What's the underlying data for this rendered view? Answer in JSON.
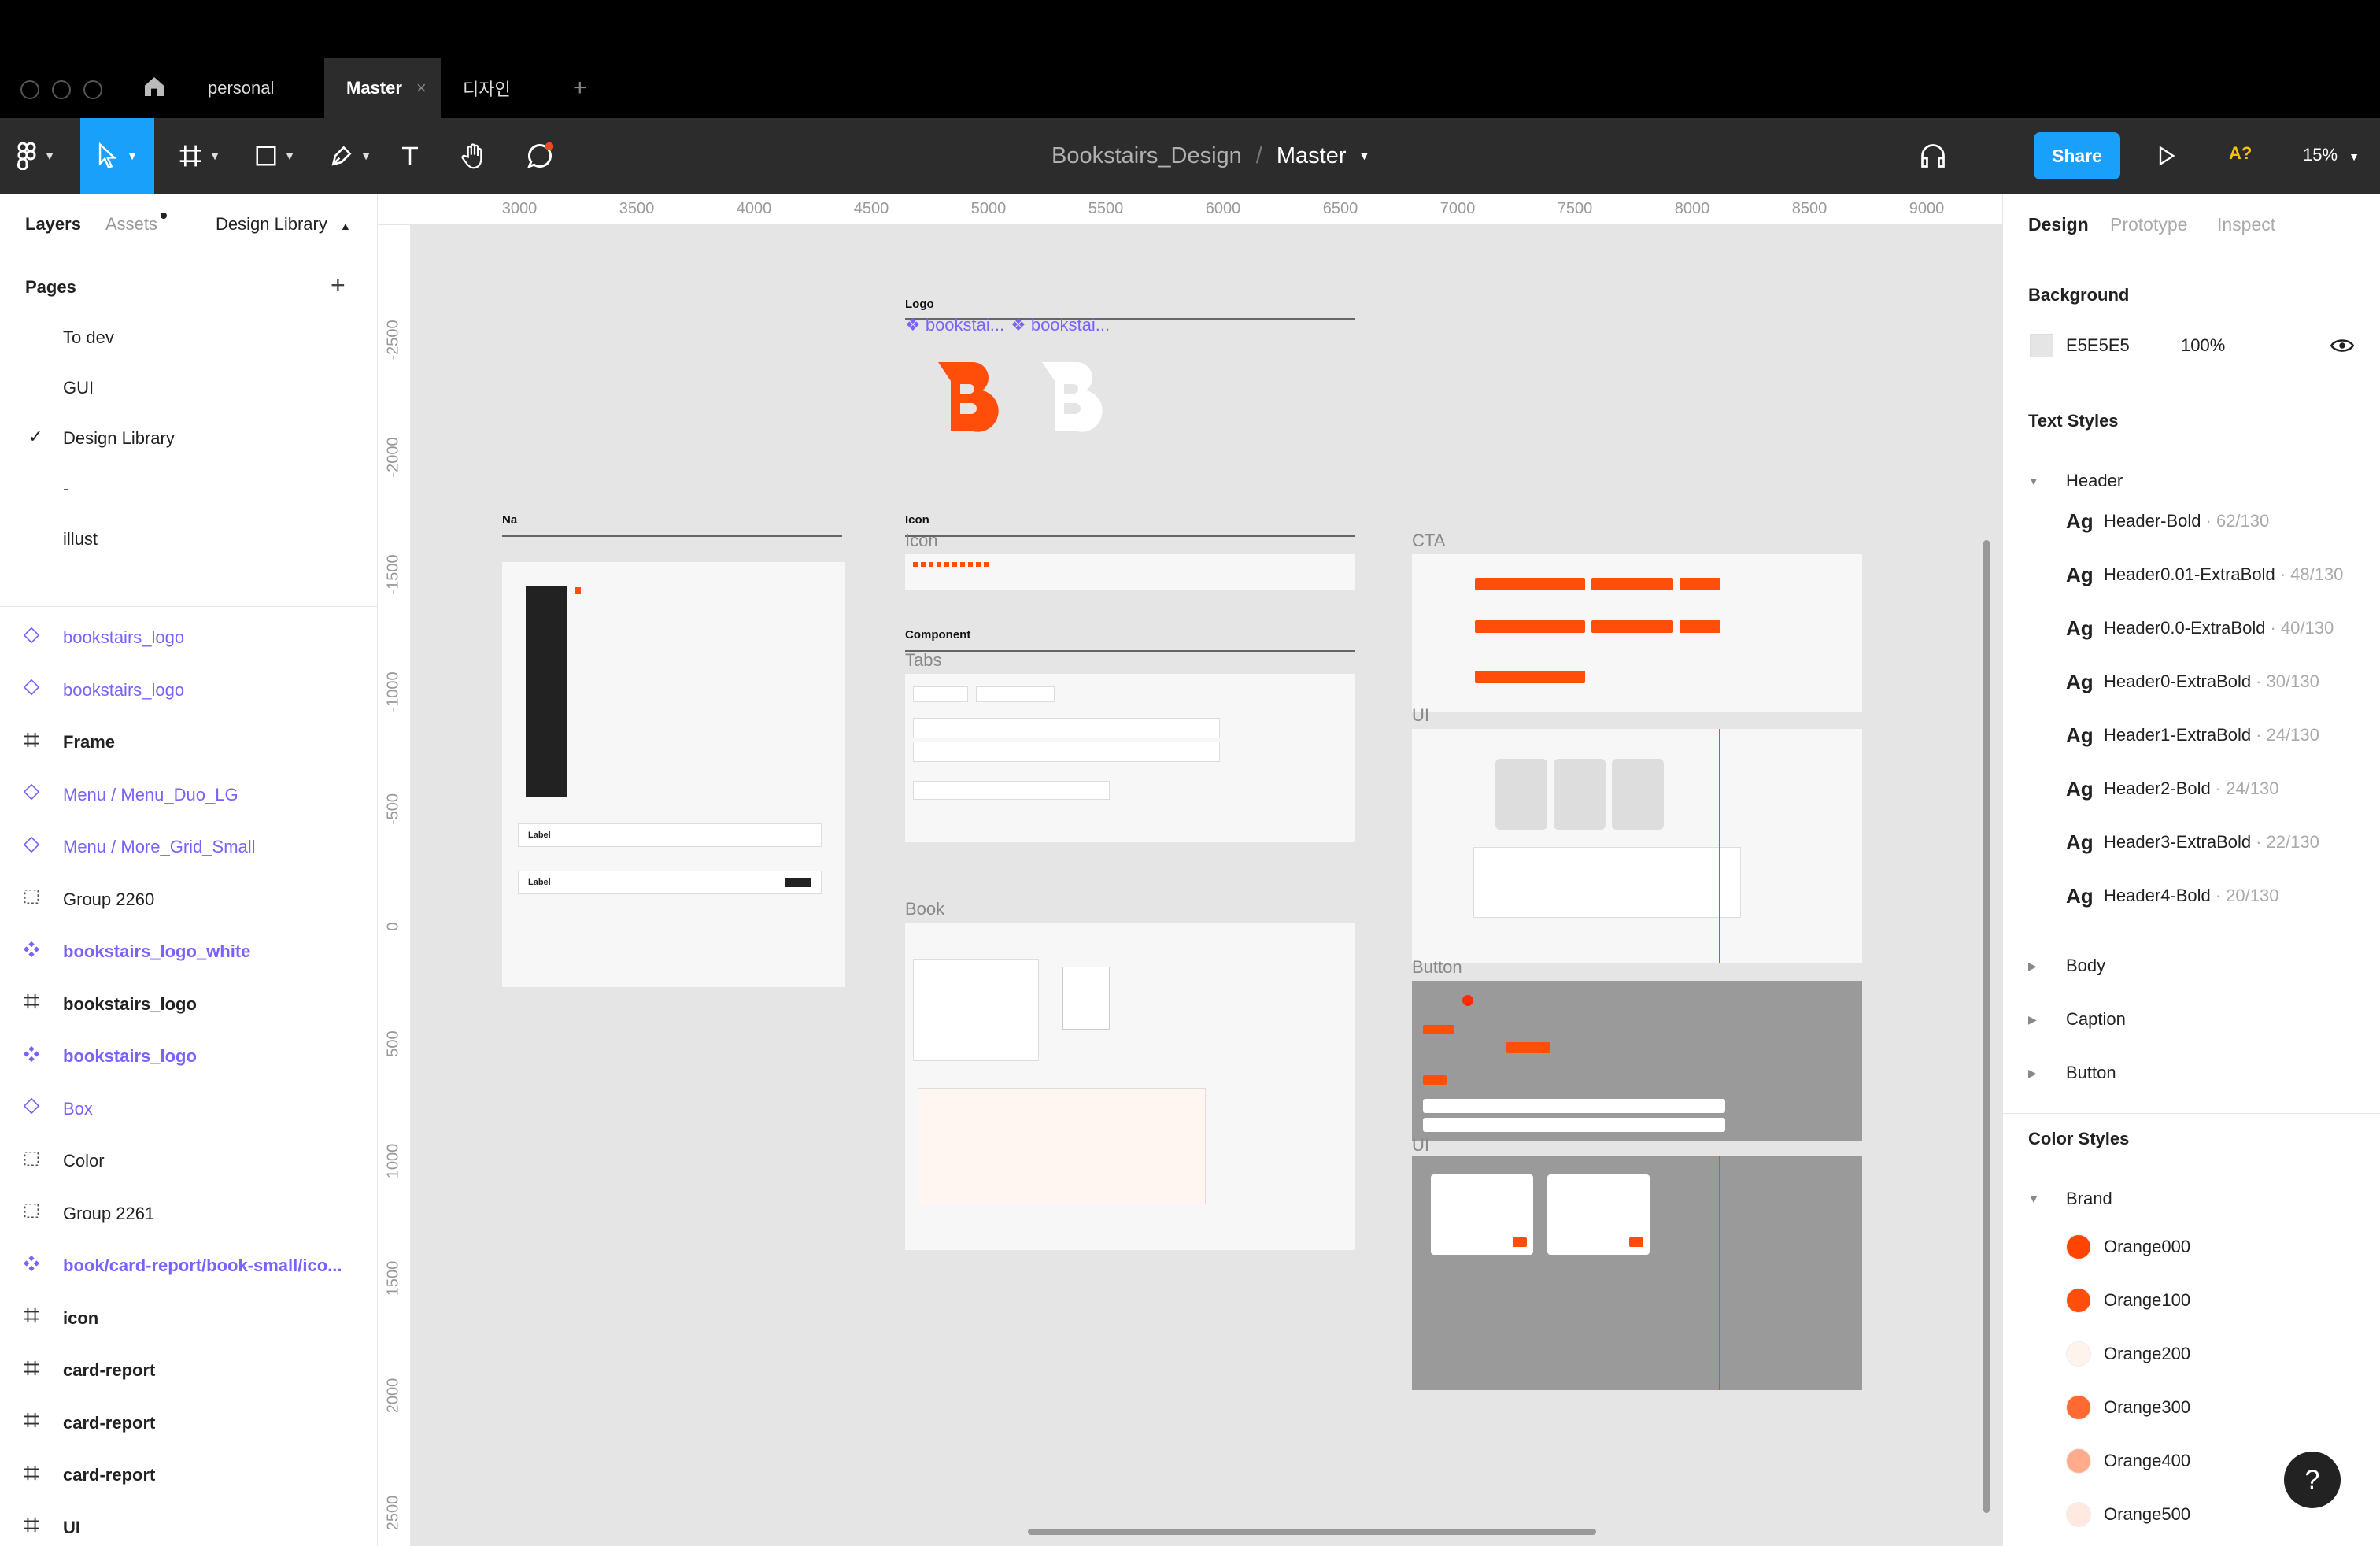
{
  "tabs": {
    "personal": "personal",
    "master": "Master",
    "master_close": "×",
    "design_kr": "디자인",
    "add": "+"
  },
  "toolbar": {
    "file_name": "Bookstairs_Design",
    "separator": "/",
    "page_name": "Master",
    "share": "Share",
    "a11y": "A?",
    "zoom": "15%"
  },
  "left_panel": {
    "tabs": {
      "layers": "Layers",
      "assets": "Assets",
      "library": "Design Library"
    },
    "pages_title": "Pages",
    "add_page": "+",
    "check": "✓",
    "pages": [
      "To dev",
      "GUI",
      "Design Library",
      "-",
      "illust"
    ],
    "layers": [
      {
        "name": "bookstairs_logo",
        "kind": "component-outline"
      },
      {
        "name": "bookstairs_logo",
        "kind": "component-outline"
      },
      {
        "name": "Frame",
        "kind": "frame"
      },
      {
        "name": "Menu / Menu_Duo_LG",
        "kind": "component-outline"
      },
      {
        "name": "Menu / More_Grid_Small",
        "kind": "component-outline"
      },
      {
        "name": "Group 2260",
        "kind": "group"
      },
      {
        "name": "bookstairs_logo_white",
        "kind": "component"
      },
      {
        "name": "bookstairs_logo",
        "kind": "frame"
      },
      {
        "name": "bookstairs_logo",
        "kind": "component"
      },
      {
        "name": "Box",
        "kind": "component-outline"
      },
      {
        "name": "Color",
        "kind": "group"
      },
      {
        "name": "Group 2261",
        "kind": "group"
      },
      {
        "name": "book/card-report/book-small/ico...",
        "kind": "component"
      },
      {
        "name": "icon",
        "kind": "frame"
      },
      {
        "name": "card-report",
        "kind": "frame"
      },
      {
        "name": "card-report",
        "kind": "frame"
      },
      {
        "name": "card-report",
        "kind": "frame"
      },
      {
        "name": "UI",
        "kind": "frame"
      },
      {
        "name": "UI",
        "kind": "frame"
      }
    ]
  },
  "rulers": {
    "h": [
      "3000",
      "3500",
      "4000",
      "4500",
      "5000",
      "5500",
      "6000",
      "6500",
      "7000",
      "7500",
      "8000",
      "8500",
      "9000"
    ],
    "v": [
      "-2500",
      "-2000",
      "-1500",
      "-1000",
      "-500",
      "0",
      "500",
      "1000",
      "1500",
      "2000",
      "2500"
    ]
  },
  "canvas": {
    "logo_label": "Logo",
    "logo_instance_1": "❖ bookstai...",
    "logo_instance_2": "❖ bookstai...",
    "nav_label": "Na",
    "icon_label": "Icon",
    "icon_frame": "Icon",
    "component_label": "Component",
    "tabs_frame": "Tabs",
    "book_frame": "Book",
    "cta_frame": "CTA",
    "ui_frame_1": "UI",
    "button_frame": "Button",
    "ui_frame_2": "UI",
    "label_1": "Label",
    "label_2": "Label"
  },
  "right_panel": {
    "tabs": {
      "design": "Design",
      "prototype": "Prototype",
      "inspect": "Inspect"
    },
    "background_title": "Background",
    "bg_hex": "E5E5E5",
    "bg_opacity": "100%",
    "text_styles_title": "Text Styles",
    "header_group": "Header",
    "ag": "Ag",
    "text_styles": [
      {
        "name": "Header-Bold",
        "meta": "· 62/130"
      },
      {
        "name": "Header0.01-ExtraBold",
        "meta": "· 48/130"
      },
      {
        "name": "Header0.0-ExtraBold",
        "meta": "· 40/130"
      },
      {
        "name": "Header0-ExtraBold",
        "meta": "· 30/130"
      },
      {
        "name": "Header1-ExtraBold",
        "meta": "· 24/130"
      },
      {
        "name": "Header2-Bold",
        "meta": "· 24/130"
      },
      {
        "name": "Header3-ExtraBold",
        "meta": "· 22/130"
      },
      {
        "name": "Header4-Bold",
        "meta": "· 20/130"
      }
    ],
    "collapsed_groups": [
      "Body",
      "Caption",
      "Button"
    ],
    "color_styles_title": "Color Styles",
    "brand_group": "Brand",
    "colors": [
      {
        "name": "Orange000",
        "hex": "#ff4400"
      },
      {
        "name": "Orange100",
        "hex": "#ff4d0a"
      },
      {
        "name": "Orange200",
        "hex": "#fff3ee"
      },
      {
        "name": "Orange300",
        "hex": "#ff6a33"
      },
      {
        "name": "Orange400",
        "hex": "#ffab8c"
      },
      {
        "name": "Orange500",
        "hex": "#ffe9e1"
      }
    ],
    "help": "?"
  },
  "colors": {
    "accent": "#18a0fb",
    "brand": "#ff4d0a",
    "component": "#7b61ff",
    "canvas": "#e5e5e5"
  }
}
